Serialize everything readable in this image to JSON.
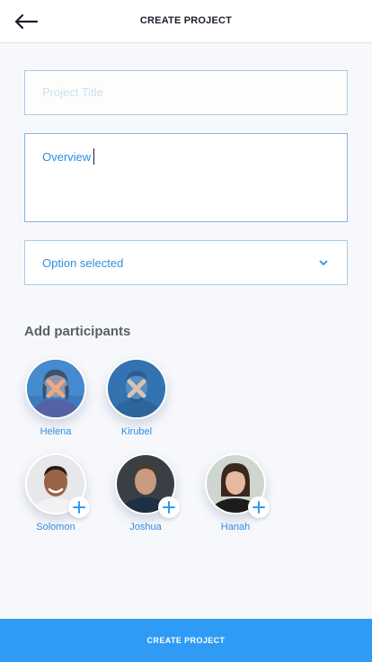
{
  "header": {
    "title": "CREATE PROJECT",
    "back_icon": "arrow-left-icon"
  },
  "form": {
    "title_placeholder": "Project Title",
    "title_value": "",
    "overview_value": "Overview",
    "select_value": "Option selected",
    "select_icon": "chevron-down-icon"
  },
  "participants": {
    "heading": "Add participants",
    "selected": [
      {
        "name": "Helena",
        "action_icon": "remove-x-icon"
      },
      {
        "name": "Kirubel",
        "action_icon": "remove-x-icon"
      }
    ],
    "available": [
      {
        "name": "Solomon",
        "action_icon": "plus-icon"
      },
      {
        "name": "Joshua",
        "action_icon": "plus-icon"
      },
      {
        "name": "Hanah",
        "action_icon": "plus-icon"
      }
    ]
  },
  "footer": {
    "submit_label": "CREATE PROJECT"
  },
  "colors": {
    "accent": "#2f9bf5",
    "link": "#2f8fe0",
    "field_border": "#a9cbe9",
    "background": "#f7f8fc"
  }
}
